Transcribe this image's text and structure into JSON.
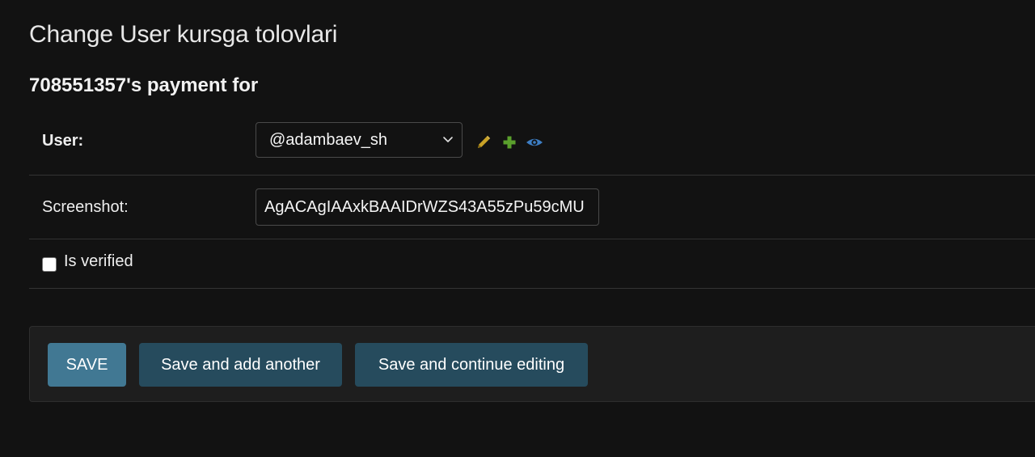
{
  "page": {
    "title": "Change User kursga tolovlari",
    "object_heading": "708551357's payment for"
  },
  "fields": {
    "user": {
      "label": "User:",
      "selected": "@adambaev_sh",
      "related_actions": [
        "pencil-icon",
        "plus-icon",
        "eye-icon"
      ]
    },
    "screenshot": {
      "label": "Screenshot:",
      "value": "AgACAgIAAxkBAAIDrWZS43A55zPu59cMU"
    },
    "is_verified": {
      "label": "Is verified",
      "checked": false
    }
  },
  "buttons": {
    "save": "SAVE",
    "save_add": "Save and add another",
    "save_continue": "Save and continue editing"
  },
  "colors": {
    "background": "#121212",
    "save_button": "#417893",
    "secondary_button": "#264b5d",
    "edit_icon": "#c9a227",
    "add_icon": "#5aa02c",
    "view_icon": "#3d7ec4"
  }
}
